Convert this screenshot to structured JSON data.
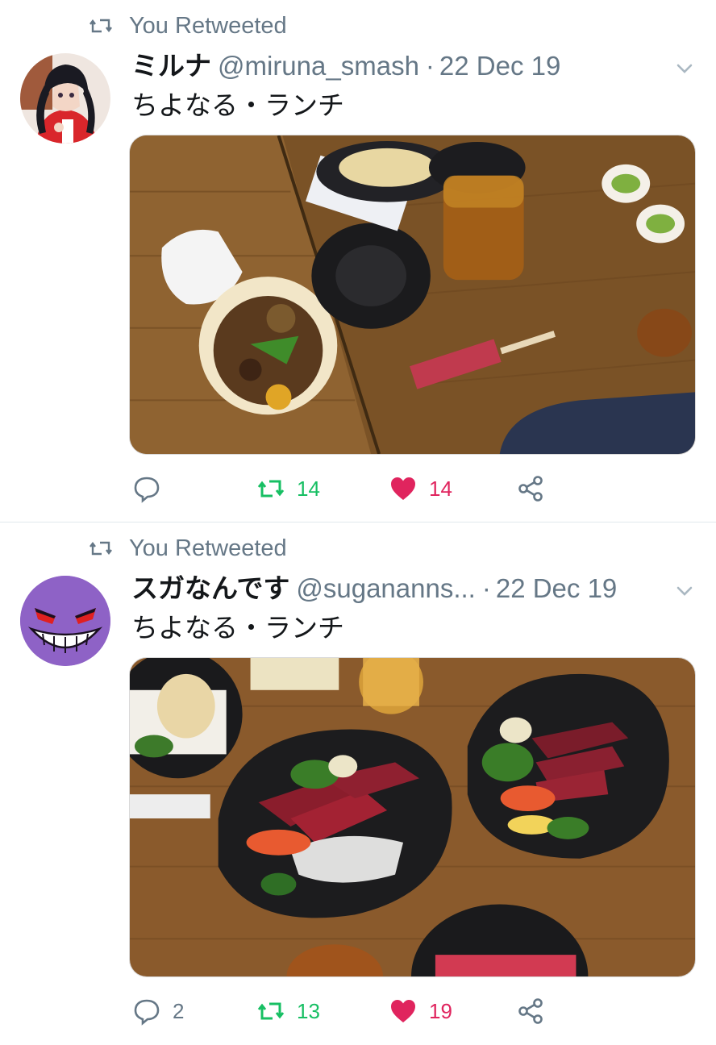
{
  "tweets": [
    {
      "retweet_label": "You Retweeted",
      "display_name": "ミルナ",
      "handle": "@miruna_smash",
      "separator": "·",
      "date": "22 Dec 19",
      "text": "ちよなる・ランチ",
      "reply_count": "",
      "retweet_count": "14",
      "like_count": "14",
      "avatar_icon": "anime-girl-avatar",
      "media_description": "food-photo"
    },
    {
      "retweet_label": "You Retweeted",
      "display_name": "スガなんです",
      "handle": "@sugananns...",
      "separator": "·",
      "date": "22 Dec 19",
      "text": "ちよなる・ランチ",
      "reply_count": "2",
      "retweet_count": "13",
      "like_count": "19",
      "avatar_icon": "purple-ghost-avatar",
      "media_description": "food-photo"
    }
  ],
  "colors": {
    "retweet_green": "#17bf63",
    "like_red": "#e0245e",
    "muted_gray": "#657786",
    "text_black": "#14171a"
  }
}
